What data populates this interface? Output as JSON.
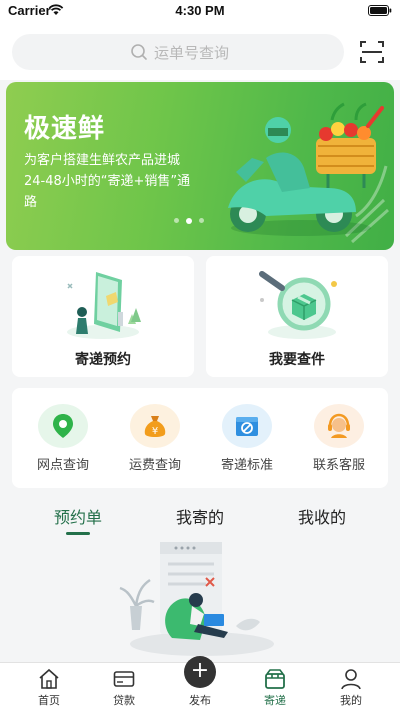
{
  "status_bar": {
    "carrier": "Carrier",
    "time": "4:30 PM"
  },
  "header": {
    "search_placeholder": "运单号查询",
    "search_icon": "search-icon",
    "scan_icon": "scan-icon"
  },
  "banner": {
    "title": "极速鲜",
    "description": "为客户搭建生鲜农产品进城24-48小时的“寄递+销售”通路",
    "page_count": 3,
    "active_page": 2,
    "colors": {
      "start": "#8fcd50",
      "end": "#41af46"
    }
  },
  "quick_cards": [
    {
      "label": "寄递预约",
      "icon": "phone-package-illustration"
    },
    {
      "label": "我要查件",
      "icon": "magnifier-package-illustration"
    }
  ],
  "services": [
    {
      "label": "网点查询",
      "icon": "location-pin-icon",
      "color": "#2fb34a"
    },
    {
      "label": "运费查询",
      "icon": "money-bag-icon",
      "color": "#f29d1c"
    },
    {
      "label": "寄递标准",
      "icon": "restricted-box-icon",
      "color": "#2f8fe0"
    },
    {
      "label": "联系客服",
      "icon": "headset-icon",
      "color": "#f39a23"
    }
  ],
  "order_tabs": [
    {
      "label": "预约单",
      "active": true
    },
    {
      "label": "我寄的",
      "active": false
    },
    {
      "label": "我收的",
      "active": false
    }
  ],
  "empty_state": {
    "icon": "empty-orders-illustration"
  },
  "tabbar": [
    {
      "label": "首页",
      "icon": "home-icon",
      "active": false
    },
    {
      "label": "贷款",
      "icon": "card-icon",
      "active": false
    },
    {
      "label": "发布",
      "icon": "plus-icon",
      "active": false
    },
    {
      "label": "寄递",
      "icon": "parcel-box-icon",
      "active": true
    },
    {
      "label": "我的",
      "icon": "user-icon",
      "active": false
    }
  ],
  "accent_color": "#23704a"
}
